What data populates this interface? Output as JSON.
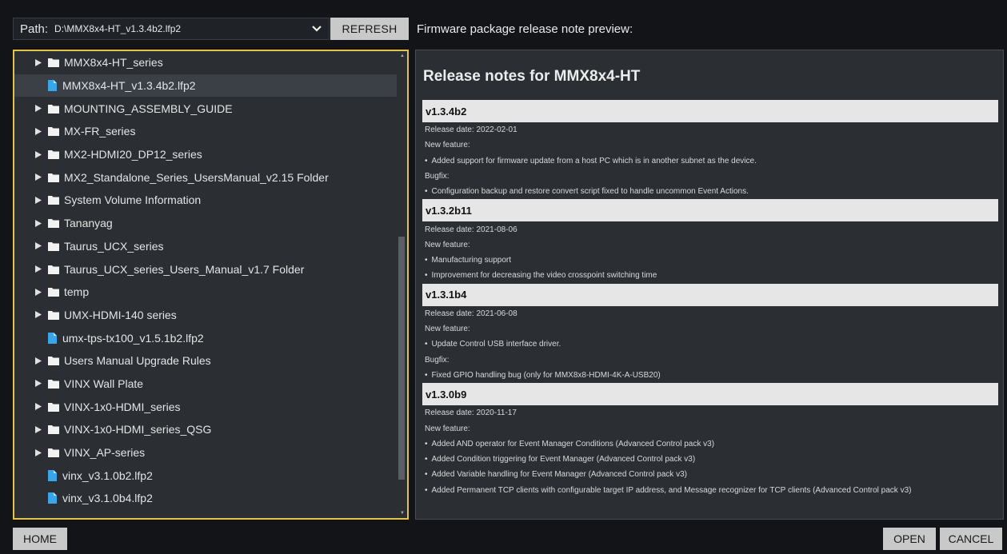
{
  "path_bar": {
    "label": "Path:",
    "value": "D:\\MMX8x4-HT_v1.3.4b2.lfp2",
    "refresh_label": "REFRESH"
  },
  "preview": {
    "title": "Firmware package release note preview:"
  },
  "tree": {
    "items": [
      {
        "type": "folder",
        "name": "MMX8x4-HT_series"
      },
      {
        "type": "file",
        "name": "MMX8x4-HT_v1.3.4b2.lfp2",
        "selected": true
      },
      {
        "type": "folder",
        "name": "MOUNTING_ASSEMBLY_GUIDE"
      },
      {
        "type": "folder",
        "name": "MX-FR_series"
      },
      {
        "type": "folder",
        "name": "MX2-HDMI20_DP12_series"
      },
      {
        "type": "folder",
        "name": "MX2_Standalone_Series_UsersManual_v2.15 Folder"
      },
      {
        "type": "folder",
        "name": "System Volume Information"
      },
      {
        "type": "folder",
        "name": "Tananyag"
      },
      {
        "type": "folder",
        "name": "Taurus_UCX_series"
      },
      {
        "type": "folder",
        "name": "Taurus_UCX_series_Users_Manual_v1.7 Folder"
      },
      {
        "type": "folder",
        "name": "temp"
      },
      {
        "type": "folder",
        "name": "UMX-HDMI-140 series"
      },
      {
        "type": "file",
        "name": "umx-tps-tx100_v1.5.1b2.lfp2"
      },
      {
        "type": "folder",
        "name": "Users Manual Upgrade Rules"
      },
      {
        "type": "folder",
        "name": "VINX Wall Plate"
      },
      {
        "type": "folder",
        "name": "VINX-1x0-HDMI_series"
      },
      {
        "type": "folder",
        "name": "VINX-1x0-HDMI_series_QSG"
      },
      {
        "type": "folder",
        "name": "VINX_AP-series"
      },
      {
        "type": "file",
        "name": "vinx_v3.1.0b2.lfp2"
      },
      {
        "type": "file",
        "name": "vinx_v3.1.0b4.lfp2"
      }
    ]
  },
  "notes": {
    "title": "Release notes for MMX8x4-HT",
    "versions": [
      {
        "version": "v1.3.4b2",
        "lines": [
          {
            "kind": "text",
            "text": "Release date: 2022-02-01"
          },
          {
            "kind": "text",
            "text": "New feature:"
          },
          {
            "kind": "bullet",
            "text": "Added support for firmware update from a host PC which is in another subnet as the device."
          },
          {
            "kind": "text",
            "text": "Bugfix:"
          },
          {
            "kind": "bullet",
            "text": "Configuration backup and restore convert script fixed to handle uncommon Event Actions."
          }
        ]
      },
      {
        "version": "v1.3.2b11",
        "lines": [
          {
            "kind": "text",
            "text": "Release date: 2021-08-06"
          },
          {
            "kind": "text",
            "text": "New feature:"
          },
          {
            "kind": "bullet",
            "text": "Manufacturing support"
          },
          {
            "kind": "bullet",
            "text": "Improvement for decreasing the video crosspoint switching time"
          }
        ]
      },
      {
        "version": "v1.3.1b4",
        "lines": [
          {
            "kind": "text",
            "text": "Release date: 2021-06-08"
          },
          {
            "kind": "text",
            "text": "New feature:"
          },
          {
            "kind": "bullet",
            "text": "Update Control USB interface driver."
          },
          {
            "kind": "text",
            "text": "Bugfix:"
          },
          {
            "kind": "bullet",
            "text": "Fixed GPIO handling bug (only for MMX8x8-HDMI-4K-A-USB20)"
          }
        ]
      },
      {
        "version": "v1.3.0b9",
        "lines": [
          {
            "kind": "text",
            "text": "Release date: 2020-11-17"
          },
          {
            "kind": "text",
            "text": "New feature:"
          },
          {
            "kind": "bullet",
            "text": "Added AND operator for Event Manager Conditions (Advanced Control pack v3)"
          },
          {
            "kind": "bullet",
            "text": "Added Condition triggering for Event Manager (Advanced Control pack v3)"
          },
          {
            "kind": "bullet",
            "text": "Added Variable handling for Event Manager (Advanced Control pack v3)"
          },
          {
            "kind": "bullet",
            "text": "Added Permanent TCP clients with configurable target IP address, and Message recognizer for TCP clients (Advanced Control pack v3)"
          }
        ]
      }
    ]
  },
  "buttons": {
    "home": "HOME",
    "open": "OPEN",
    "cancel": "CANCEL"
  },
  "colors": {
    "tree_focus_border": "#e2c24a",
    "file_icon": "#3aa6e8",
    "folder_icon": "#f2f2f2"
  }
}
